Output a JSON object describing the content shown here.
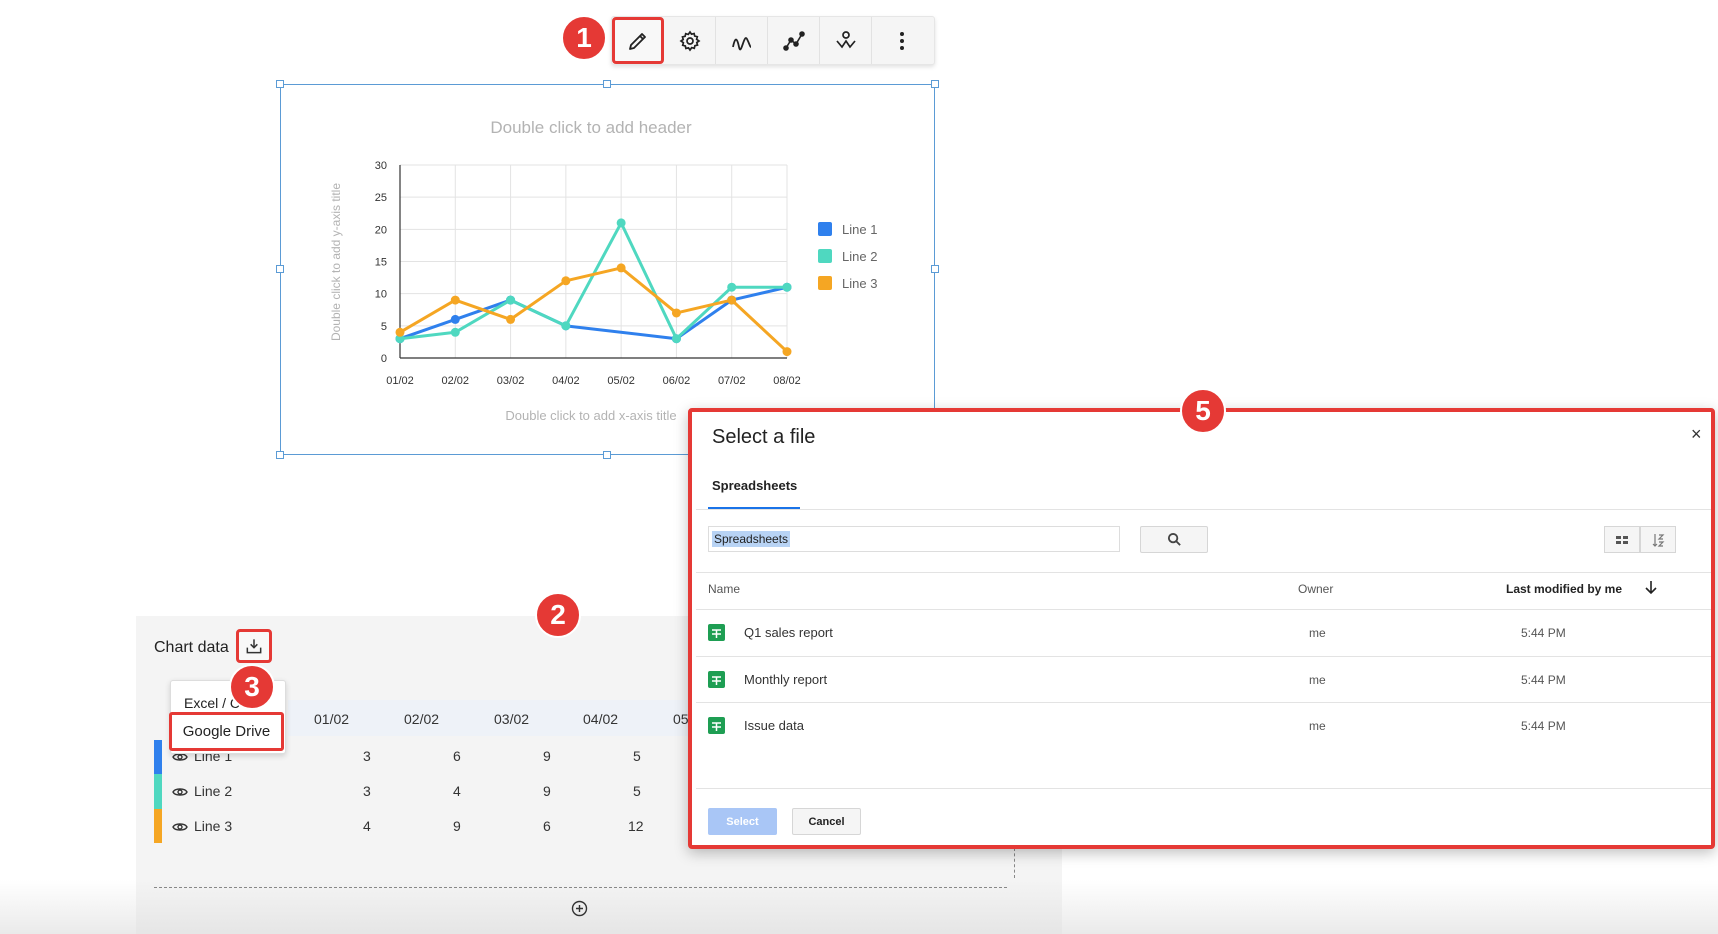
{
  "toolbar": {
    "items": [
      {
        "name": "edit-data",
        "icon": "pencil-icon"
      },
      {
        "name": "settings",
        "icon": "gear-icon"
      },
      {
        "name": "chart-type",
        "icon": "wave-icon"
      },
      {
        "name": "line-style",
        "icon": "line-chart-icon"
      },
      {
        "name": "markers",
        "icon": "marker-icon"
      },
      {
        "name": "more",
        "icon": "more-vertical-icon"
      }
    ]
  },
  "step_badges": {
    "one": "1",
    "two": "2",
    "three": "3",
    "five": "5"
  },
  "chart_data": {
    "type": "line",
    "title": "Double click to add header",
    "xlabel": "Double click to add x-axis title",
    "ylabel": "Double click to add y-axis title",
    "categories": [
      "01/02",
      "02/02",
      "03/02",
      "04/02",
      "05/02",
      "06/02",
      "07/02",
      "08/02"
    ],
    "yticks": [
      "0",
      "5",
      "10",
      "15",
      "20",
      "25",
      "30"
    ],
    "ylim": [
      0,
      30
    ],
    "grid": true,
    "legend_position": "right",
    "series": [
      {
        "name": "Line 1",
        "color": "#2f80ed",
        "values": [
          3,
          6,
          9,
          5,
          null,
          3,
          9,
          11
        ]
      },
      {
        "name": "Line 2",
        "color": "#4fd8c0",
        "values": [
          3,
          4,
          9,
          5,
          21,
          3,
          11,
          11
        ]
      },
      {
        "name": "Line 3",
        "color": "#f5a623",
        "values": [
          4,
          9,
          6,
          12,
          14,
          7,
          9,
          1
        ]
      }
    ]
  },
  "chart_panel": {
    "title": "Chart data",
    "import_icon": "import-icon",
    "dropdown": {
      "item1": "Excel / C",
      "item2": "Google Drive"
    },
    "columns": [
      "01/02",
      "02/02",
      "03/02",
      "04/02",
      "05"
    ],
    "rows": [
      {
        "label": "Line 1",
        "color": "#2f80ed",
        "values": [
          "3",
          "6",
          "9",
          "5"
        ]
      },
      {
        "label": "Line 2",
        "color": "#4fd8c0",
        "values": [
          "3",
          "4",
          "9",
          "5"
        ]
      },
      {
        "label": "Line 3",
        "color": "#f5a623",
        "values": [
          "4",
          "9",
          "6",
          "12"
        ]
      }
    ],
    "add_icon": "plus-circle-icon"
  },
  "dialog": {
    "title": "Select a file",
    "close": "×",
    "tab": "Spreadsheets",
    "search_value": "Spreadsheets",
    "columns": {
      "name": "Name",
      "owner": "Owner",
      "modified": "Last modified by me"
    },
    "files": [
      {
        "name": "Q1 sales report",
        "owner": "me",
        "modified": "5:44 PM"
      },
      {
        "name": "Monthly report",
        "owner": "me",
        "modified": "5:44 PM"
      },
      {
        "name": "Issue data",
        "owner": "me",
        "modified": "5:44 PM"
      }
    ],
    "select_label": "Select",
    "cancel_label": "Cancel"
  }
}
